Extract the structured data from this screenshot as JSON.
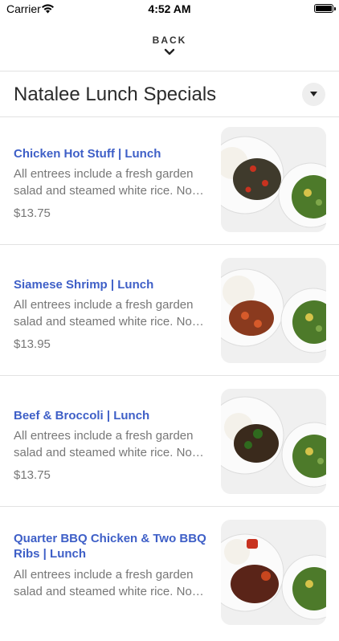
{
  "status_bar": {
    "carrier": "Carrier",
    "time": "4:52 AM"
  },
  "nav": {
    "back_label": "BACK"
  },
  "category": {
    "title": "Natalee Lunch Specials"
  },
  "items": [
    {
      "name": "Chicken Hot Stuff | Lunch",
      "desc_line1": "All entrees include a fresh garden",
      "desc_line2": "salad and steamed white rice. No…",
      "price": "$13.75",
      "dish_color": "#3f3a2c",
      "accent_color": "#c8321f"
    },
    {
      "name": "Siamese Shrimp | Lunch",
      "desc_line1": "All entrees include a fresh garden",
      "desc_line2": "salad and steamed white rice. No…",
      "price": "$13.95",
      "dish_color": "#8a3a1e",
      "accent_color": "#d65a2a"
    },
    {
      "name": "Beef & Broccoli | Lunch",
      "desc_line1": "All entrees include a fresh garden",
      "desc_line2": "salad and steamed white rice. No…",
      "price": "$13.75",
      "dish_color": "#3a2a1c",
      "accent_color": "#2f6a1e"
    },
    {
      "name_line1": "Quarter BBQ Chicken & Two BBQ",
      "name_line2": "Ribs | Lunch",
      "desc_line1": "All entrees include a fresh garden",
      "desc_line2": "salad and steamed white rice. No…",
      "dish_color": "#5a2418",
      "accent_color": "#c8461e"
    }
  ]
}
